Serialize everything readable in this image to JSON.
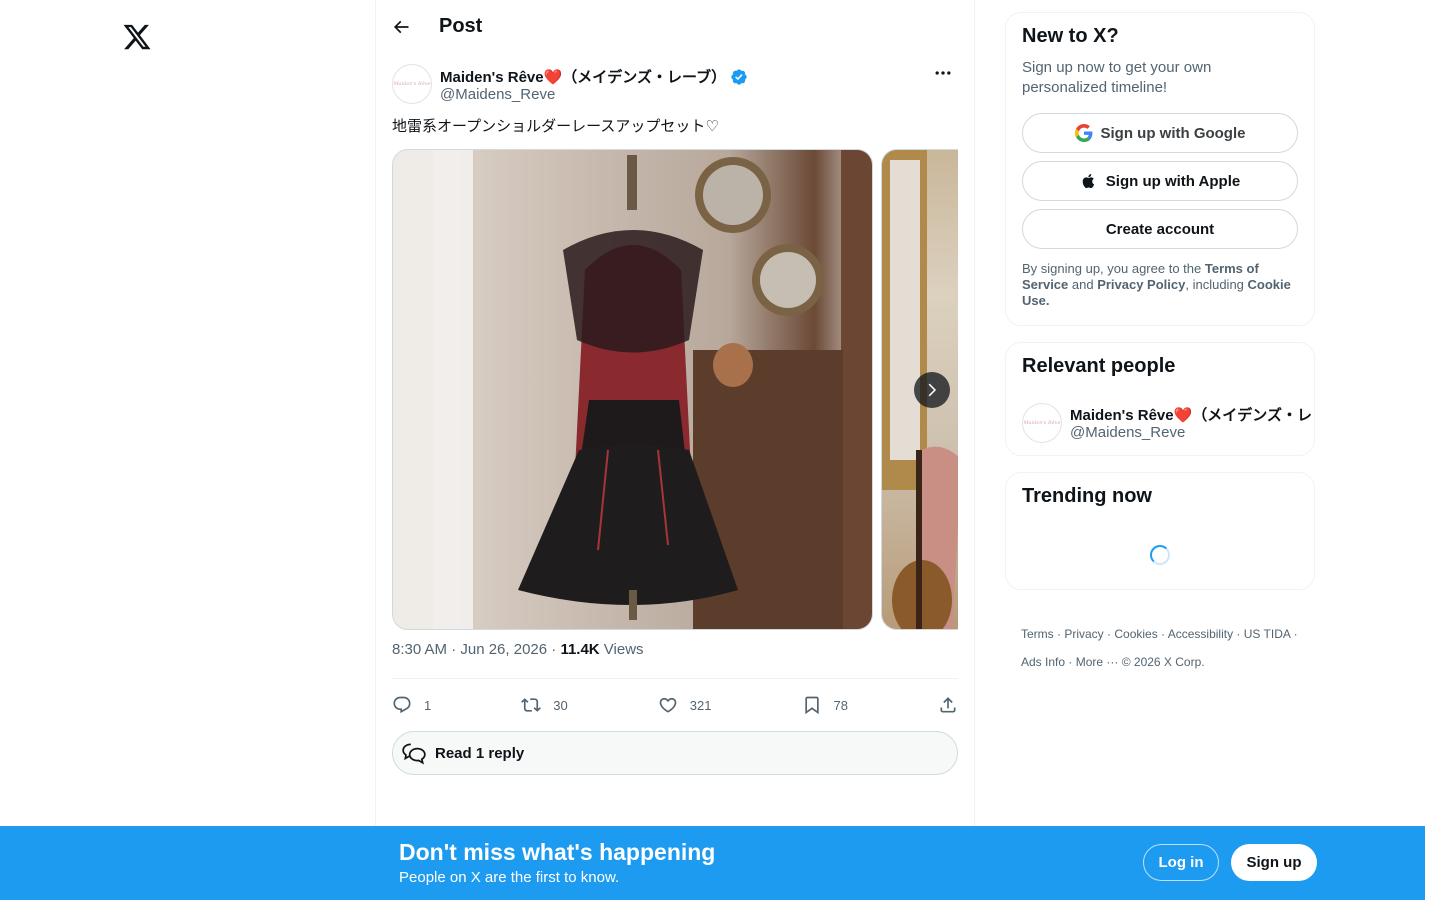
{
  "header": {
    "title": "Post"
  },
  "tweet": {
    "author_name": "Maiden's Rêve❤️（メイデンズ・レーブ）",
    "author_handle": "@Maidens_Reve",
    "avatar_text": "Maiden's Rêve",
    "text": "地雷系オープンショルダーレースアップセット♡",
    "time": "8:30 AM · Jun 26, 2026 · ",
    "views_count": "11.4K",
    "views_label": " Views",
    "replies": "1",
    "reposts": "30",
    "likes": "321",
    "bookmarks": "78",
    "read_reply": "Read 1 reply"
  },
  "sidebar": {
    "newx_title": "New to X?",
    "newx_sub": "Sign up now to get your own personalized timeline!",
    "google_label": "Sign up with Google",
    "apple_label": "Sign up with Apple",
    "create_label": "Create account",
    "legal_prefix": "By signing up, you agree to the ",
    "legal_terms": "Terms of Service",
    "legal_and": " and ",
    "legal_privacy": "Privacy Policy",
    "legal_including": ", including ",
    "legal_cookie": "Cookie Use.",
    "people_title": "Relevant people",
    "person_name": "Maiden's Rêve❤️（メイデンズ・レーブ）",
    "person_handle": "@Maidens_Reve",
    "trending_title": "Trending now"
  },
  "footer": {
    "links": [
      "Terms",
      "Privacy",
      "Cookies",
      "Accessibility",
      "US TIDA",
      "Ads Info",
      "More ···",
      "© 2026 X Corp."
    ]
  },
  "banner": {
    "title": "Don't miss what's happening",
    "subtitle": "People on X are the first to know.",
    "login": "Log in",
    "signup": "Sign up"
  },
  "colors": {
    "accent": "#1d9bf0",
    "text": "#0f1419",
    "muted": "#536471"
  }
}
